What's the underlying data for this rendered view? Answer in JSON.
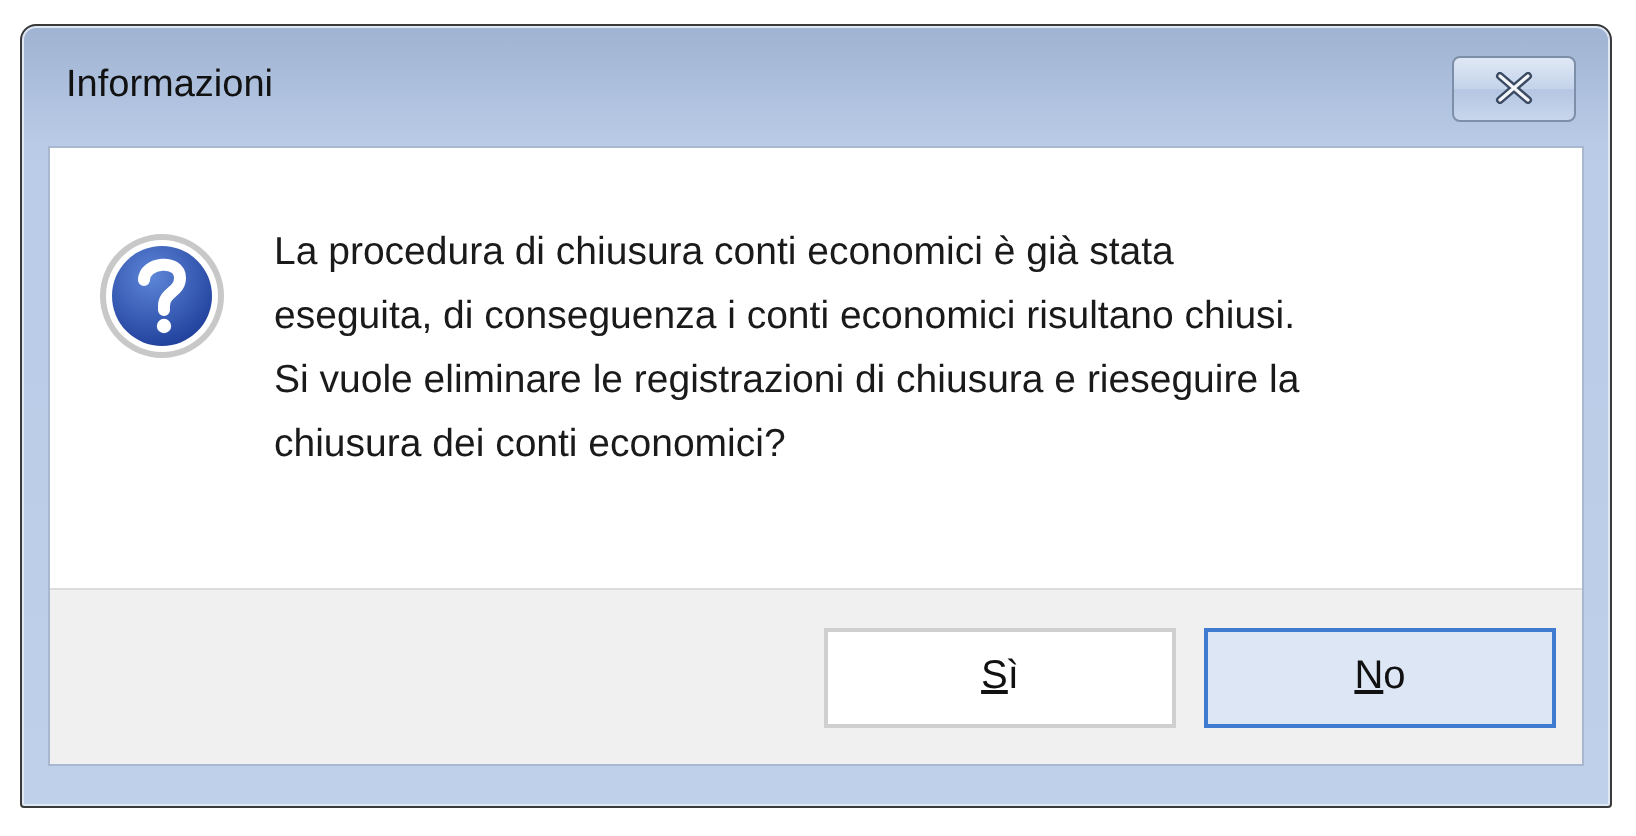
{
  "window": {
    "title": "Informazioni"
  },
  "message": {
    "lines": [
      "La procedura di chiusura conti economici è già stata",
      "eseguita, di conseguenza i conti economici risultano chiusi.",
      "Si vuole eliminare le registrazioni di chiusura e rieseguire la",
      "chiusura dei conti economici?"
    ]
  },
  "buttons": [
    {
      "label": "Sì",
      "selected": false
    },
    {
      "label": "No",
      "selected": true
    }
  ]
}
